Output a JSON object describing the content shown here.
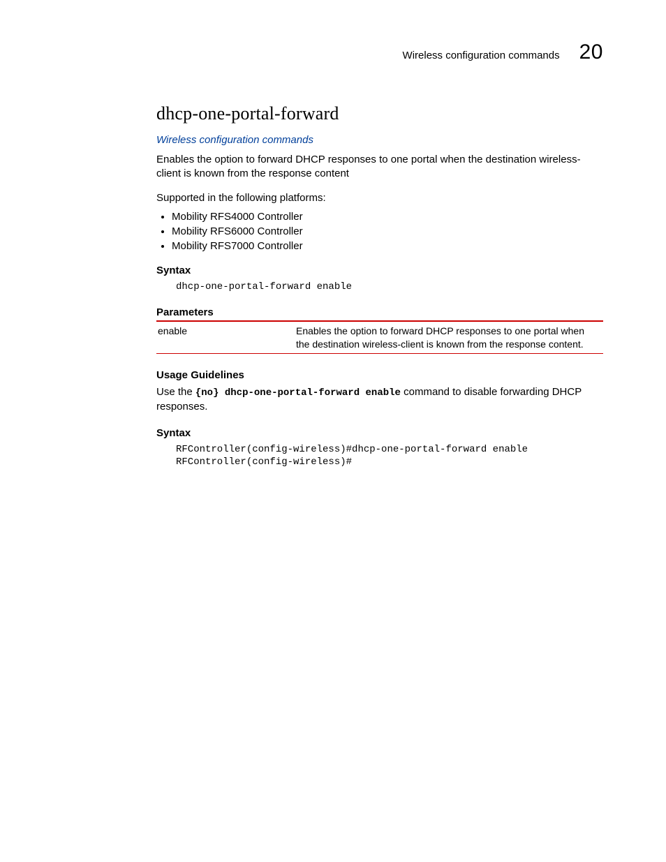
{
  "header": {
    "section": "Wireless configuration commands",
    "chapter_number": "20"
  },
  "title": "dhcp-one-portal-forward",
  "xref": "Wireless configuration commands",
  "intro": "Enables the option to forward DHCP responses to one portal when the destination wireless-client is known from the response content",
  "supported_label": "Supported in the following platforms:",
  "platforms": [
    "Mobility RFS4000 Controller",
    "Mobility RFS6000 Controller",
    "Mobility RFS7000 Controller"
  ],
  "syntax1": {
    "heading": "Syntax",
    "code": "dhcp-one-portal-forward enable"
  },
  "parameters": {
    "heading": "Parameters",
    "rows": [
      {
        "name": "enable",
        "desc": "Enables the option to forward DHCP responses to one portal when the destination wireless-client is known from the response content."
      }
    ]
  },
  "usage": {
    "heading": "Usage Guidelines",
    "pre": "Use the ",
    "code": "{no} dhcp-one-portal-forward enable",
    "post": " command to disable forwarding DHCP responses."
  },
  "syntax2": {
    "heading": "Syntax",
    "code": "RFController(config-wireless)#dhcp-one-portal-forward enable\nRFController(config-wireless)#"
  }
}
